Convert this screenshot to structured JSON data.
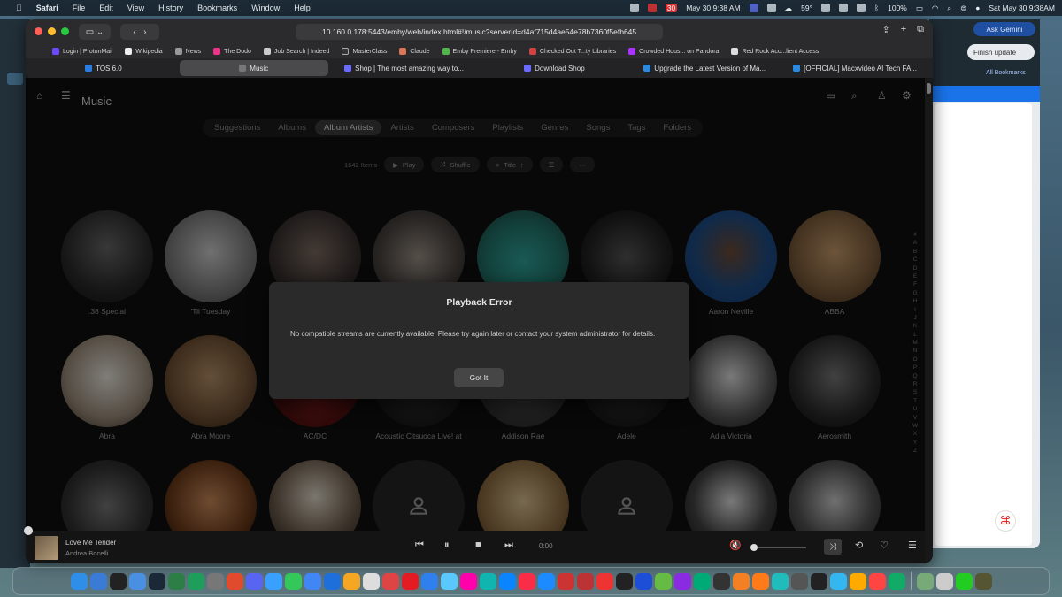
{
  "menubar": {
    "apple": "",
    "app": "Safari",
    "items": [
      "File",
      "Edit",
      "View",
      "History",
      "Bookmarks",
      "Window",
      "Help"
    ],
    "calendar_day": "30",
    "date_short": "May 30 9:38 AM",
    "temp": "59°",
    "battery": "100%",
    "clock": "Sat May 30  9:38AM"
  },
  "right_window": {
    "ask_gemini": "Ask Gemini",
    "finish_update": "Finish update",
    "all_bookmarks": "All Bookmarks"
  },
  "safari": {
    "url": "10.160.0.178:5443/emby/web/index.html#!/music?serverId=d4af715d4ae54e78b7360f5efb645",
    "favorites": [
      "Login | ProtonMail",
      "Wikipedia",
      "News",
      "The Dodo",
      "Job Search | Indeed",
      "MasterClass",
      "Claude",
      "Emby Premiere - Emby",
      "Checked Out T...ty Libraries",
      "Crowded Hous... on Pandora",
      "Red Rock Acc...lient Access"
    ],
    "tabs": [
      "TOS 6.0",
      "Music",
      "Shop | The most amazing way to...",
      "Download Shop",
      "Upgrade the Latest Version of Ma...",
      "[OFFICIAL] Macxvideo AI Tech FA..."
    ],
    "active_tab": 1
  },
  "emby": {
    "title": "Music",
    "nav_tabs": [
      "Suggestions",
      "Albums",
      "Album Artists",
      "Artists",
      "Composers",
      "Playlists",
      "Genres",
      "Songs",
      "Tags",
      "Folders"
    ],
    "selected_nav": 2,
    "count": "1642 Items",
    "play": "Play",
    "shuffle": "Shuffle",
    "sort": "Title",
    "artists": [
      {
        "name": ".38 Special"
      },
      {
        "name": "'Til Tuesday"
      },
      {
        "name": ""
      },
      {
        "name": ""
      },
      {
        "name": ""
      },
      {
        "name": ""
      },
      {
        "name": "Aaron Neville"
      },
      {
        "name": "ABBA"
      },
      {
        "name": "Abra"
      },
      {
        "name": "Abra Moore"
      },
      {
        "name": "AC/DC"
      },
      {
        "name": "Acoustic Citsuoca Live! at"
      },
      {
        "name": "Addison Rae"
      },
      {
        "name": "Adele"
      },
      {
        "name": "Adia Victoria"
      },
      {
        "name": "Aerosmith"
      },
      {
        "name": ""
      },
      {
        "name": ""
      },
      {
        "name": ""
      },
      {
        "name": ""
      },
      {
        "name": ""
      },
      {
        "name": ""
      },
      {
        "name": ""
      },
      {
        "name": ""
      }
    ],
    "alphabet": [
      "#",
      "A",
      "B",
      "C",
      "D",
      "E",
      "F",
      "G",
      "H",
      "I",
      "J",
      "K",
      "L",
      "M",
      "N",
      "O",
      "P",
      "Q",
      "R",
      "S",
      "T",
      "U",
      "V",
      "W",
      "X",
      "Y",
      "Z"
    ]
  },
  "dialog": {
    "title": "Playback Error",
    "message": "No compatible streams are currently available. Please try again later or contact your system administrator for details.",
    "button": "Got It"
  },
  "now_playing": {
    "track": "Love Me Tender",
    "artist": "Andrea Bocelli",
    "time": "0:00"
  }
}
